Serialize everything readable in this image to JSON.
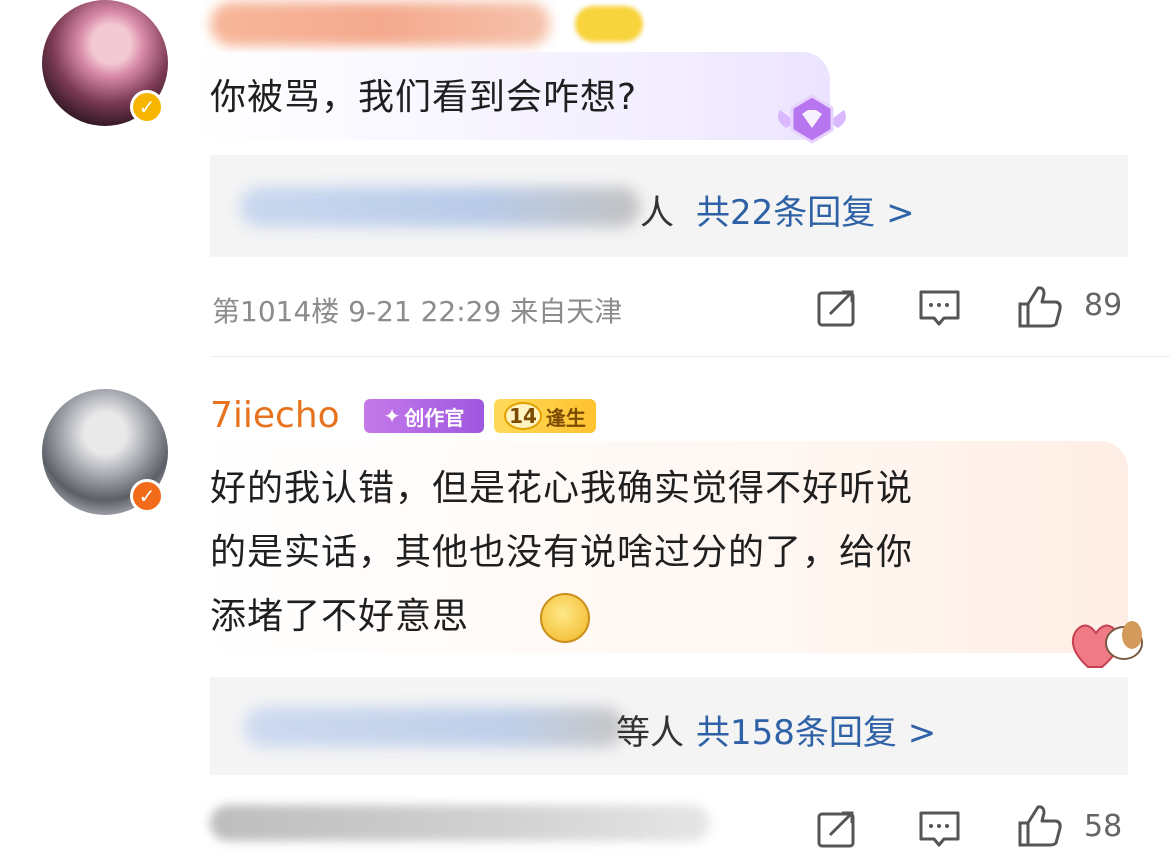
{
  "comments": [
    {
      "text": "你被骂，我们看到会咋想?",
      "reply_tail": "人",
      "reply_count": "共22条回复 >",
      "meta": "第1014楼 9-21 22:29 来自天津",
      "likes": "89"
    },
    {
      "username": "7iiecho",
      "badge_creator": "创作官",
      "badge_level_number": "14",
      "badge_level_text": "逢生",
      "text_line1": "好的我认错，但是花心我确实觉得不好听说",
      "text_line2": "的是实话，其他也没有说啥过分的了，给你",
      "text_line3": "添堵了不好意思",
      "reply_tail": "等人",
      "reply_count": "共158条回复 >",
      "likes": "58"
    }
  ],
  "icons": {
    "share": "share-icon",
    "comment": "comment-icon",
    "like": "thumbs-up-icon"
  },
  "colors": {
    "username": "#e8731f",
    "reply_link": "#2e61a6",
    "verify_yellow": "#f7b500",
    "verify_orange": "#f26b1a"
  }
}
